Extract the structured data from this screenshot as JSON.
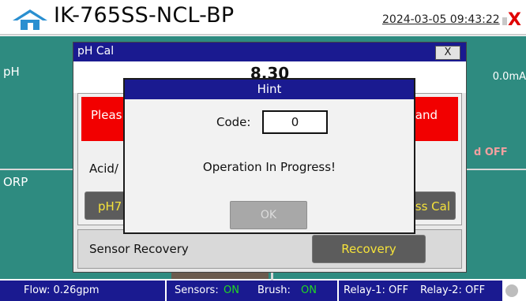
{
  "header": {
    "device_name": "IK-765SS-NCL-BP",
    "datetime": "2024-03-05 09:43:22",
    "alarm_symbol": "X",
    "home_icon": "home-icon",
    "alarm_icon": "alarm-x-icon"
  },
  "panels": {
    "ph_label": "pH",
    "orp_label": "ORP",
    "current_output": "0.0mA",
    "hold_status": "d OFF"
  },
  "cal_window": {
    "title": "pH Cal",
    "close_label": "X",
    "value": "8.30",
    "message_left": "Pleas",
    "message_right": "and",
    "acid_label": "Acid/",
    "ph7_button": "pH7",
    "pass_cal_button": "ss Cal",
    "sensor_recovery_label": "Sensor Recovery",
    "recovery_button": "Recovery"
  },
  "hint_dialog": {
    "title": "Hint",
    "code_label": "Code:",
    "code_value": "0",
    "message": "Operation In Progress!",
    "ok_button": "OK"
  },
  "status_bar": {
    "flow": "Flow:  0.26gpm",
    "sensors_label": "Sensors:",
    "sensors_value": "ON",
    "brush_label": "Brush:",
    "brush_value": "ON",
    "relay1": "Relay-1: OFF",
    "relay2": "Relay-2: OFF"
  },
  "colors": {
    "panel_teal": "#2e8b80",
    "title_blue": "#1a1a90",
    "alert_red": "#f20000",
    "button_text_yellow": "#f5e23a",
    "status_on_green": "#22d822"
  }
}
